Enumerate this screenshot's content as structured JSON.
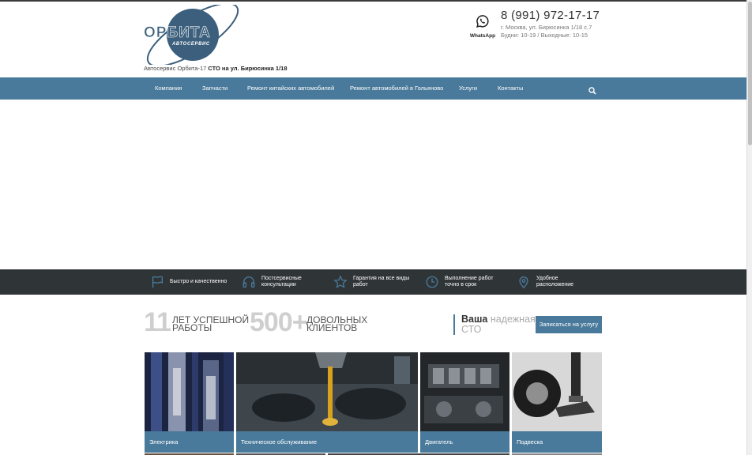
{
  "header": {
    "logo": {
      "main": "ОРБИТА",
      "sub": "АВТОСЕРВИС"
    },
    "tagline_prefix": "Автосервис Орбита-17",
    "tagline_bold": "СТО на ул. Бирюсинка 1/18",
    "whatsapp_label": "WhatsApp",
    "phone": "8 (991) 972-17-17",
    "address": "г. Москва, ул. Бирюсинка 1/18 с.7",
    "hours": "Будни: 10-19 / Выходные: 10-15"
  },
  "nav": {
    "items": [
      {
        "label": "Компания"
      },
      {
        "label": "Запчасти"
      },
      {
        "label": "Ремонт китайских автомобилей"
      },
      {
        "label": "Ремонт автомобилей в Гольяново"
      },
      {
        "label": "Услуги"
      },
      {
        "label": "Контакты"
      }
    ],
    "search_icon": "search-icon"
  },
  "features": [
    {
      "icon": "flag-icon",
      "text": "Быстро и качественно"
    },
    {
      "icon": "headphones-icon",
      "text": "Постсервисные консультации"
    },
    {
      "icon": "star-icon",
      "text": "Гарантия на все виды работ"
    },
    {
      "icon": "clock-icon",
      "text": "Выполнение работ точно в срок"
    },
    {
      "icon": "map-pin-icon",
      "text": "Удобное расположение"
    }
  ],
  "stats": [
    {
      "number": "11",
      "line1": "лет успешной",
      "line2": "работы"
    },
    {
      "number": "500+",
      "line1": "довольных",
      "line2": "клиентов"
    }
  ],
  "cta": {
    "title_bold": "Ваша",
    "title_rest": "надежная",
    "title_line2": "СТО",
    "button": "Записаться на услугу"
  },
  "accent_color": "#4a7a9b",
  "tiles": [
    {
      "label": "Электрика"
    },
    {
      "label": "Техническое обслуживание"
    },
    {
      "label": "Двигатель"
    },
    {
      "label": "Подвеска"
    }
  ]
}
